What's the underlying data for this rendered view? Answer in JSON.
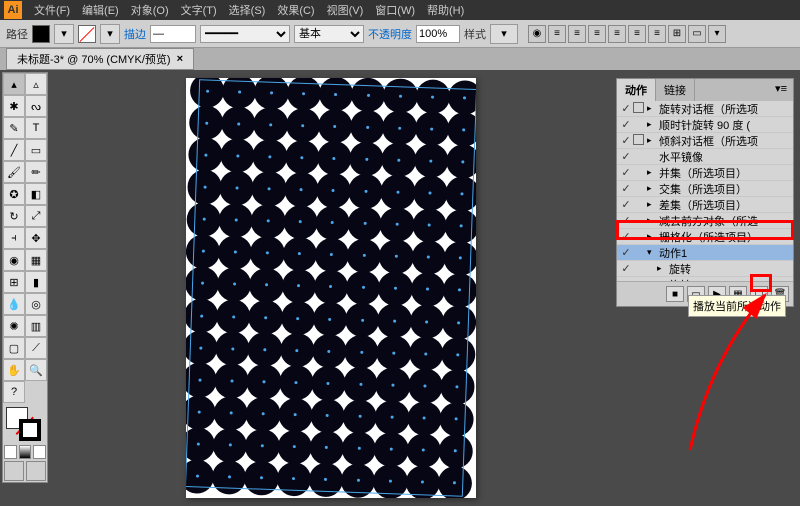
{
  "app": {
    "logo_text": "Ai"
  },
  "menus": [
    "文件(F)",
    "编辑(E)",
    "对象(O)",
    "文字(T)",
    "选择(S)",
    "效果(C)",
    "视图(V)",
    "窗口(W)",
    "帮助(H)"
  ],
  "control_bar": {
    "label": "路径",
    "stroke_label": "描边",
    "stroke_dash": "—",
    "basic_label": "基本",
    "opacity_label": "不透明度",
    "opacity_value": "100%",
    "style_label": "样式"
  },
  "document": {
    "tab_title": "未标题-3* @ 70% (CMYK/预览)",
    "close": "×"
  },
  "panel": {
    "tab_active": "动作",
    "tab_other": "链接",
    "rows": [
      {
        "chk": "✓",
        "box": true,
        "tw": "▸",
        "label": "旋转对话框（所选项"
      },
      {
        "chk": "✓",
        "box": false,
        "tw": "▸",
        "label": "顺时针旋转 90 度 ("
      },
      {
        "chk": "✓",
        "box": true,
        "tw": "▸",
        "label": "倾斜对话框（所选项"
      },
      {
        "chk": "✓",
        "box": false,
        "tw": "",
        "label": "水平镜像"
      },
      {
        "chk": "✓",
        "box": false,
        "tw": "▸",
        "label": "并集（所选项目）"
      },
      {
        "chk": "✓",
        "box": false,
        "tw": "▸",
        "label": "交集（所选项目）"
      },
      {
        "chk": "✓",
        "box": false,
        "tw": "▸",
        "label": "差集（所选项目）"
      },
      {
        "chk": "✓",
        "box": false,
        "tw": "▸",
        "label": "减去前方对象（所选"
      },
      {
        "chk": "✓",
        "box": false,
        "tw": "▸",
        "label": "栅格化（所选项目）"
      },
      {
        "chk": "✓",
        "box": false,
        "tw": "▾",
        "label": "动作1",
        "hi": true
      },
      {
        "chk": "✓",
        "box": false,
        "tw": "▸",
        "label": "旋转",
        "indent": 1
      },
      {
        "chk": "✓",
        "box": false,
        "tw": "▸",
        "label": "旋转",
        "indent": 1
      }
    ],
    "tooltip": "播放当前所选动作",
    "footer_icons": [
      "■",
      "▭",
      "▶",
      "▦",
      "☐",
      "🗑"
    ]
  },
  "chart_data": null
}
